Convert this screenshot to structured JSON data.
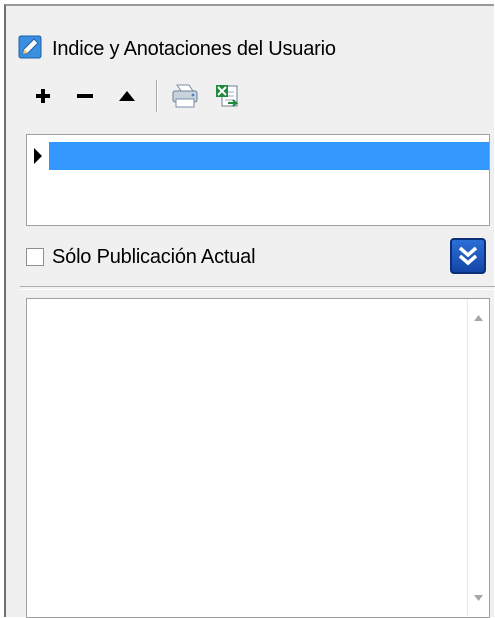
{
  "panel": {
    "title": "Indice y Anotaciones del Usuario",
    "title_icon": "pencil-icon"
  },
  "toolbar": {
    "buttons": [
      {
        "name": "add-button",
        "icon": "plus-icon"
      },
      {
        "name": "remove-button",
        "icon": "minus-icon"
      },
      {
        "name": "move-up-button",
        "icon": "triangle-up-icon"
      },
      {
        "name": "print-button",
        "icon": "printer-icon"
      },
      {
        "name": "export-button",
        "icon": "excel-export-icon"
      }
    ]
  },
  "tree": {
    "rows": [
      {
        "label": "",
        "selected": true
      }
    ],
    "selection_color": "#3399ff"
  },
  "filter": {
    "checkbox_label": "Sólo Publicación Actual",
    "checked": false,
    "expand_icon": "double-chevron-down-icon"
  },
  "colors": {
    "panel_bg": "#f0f0f0",
    "accent": "#1a56c4"
  }
}
